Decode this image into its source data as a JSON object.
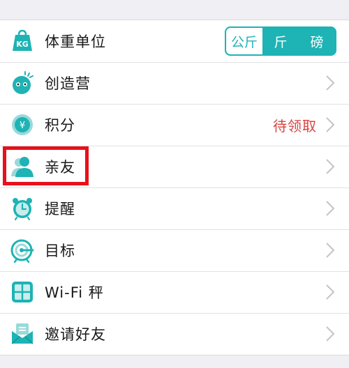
{
  "colors": {
    "accent": "#1eb3b4",
    "value_red": "#d9433f",
    "highlight": "#e8101a"
  },
  "rows": [
    {
      "label": "体重单位",
      "icon": "kg-weight-icon",
      "segment": {
        "options": [
          "公斤",
          "斤",
          "磅"
        ],
        "selected": "公斤"
      }
    },
    {
      "label": "创造营",
      "icon": "mascot-icon"
    },
    {
      "label": "积分",
      "icon": "yuan-coin-icon",
      "value": "待领取"
    },
    {
      "label": "亲友",
      "icon": "friends-icon"
    },
    {
      "label": "提醒",
      "icon": "alarm-clock-icon"
    },
    {
      "label": "目标",
      "icon": "target-icon"
    },
    {
      "label": "Wi-Fi 秤",
      "icon": "scale-icon"
    },
    {
      "label": "邀请好友",
      "icon": "envelope-icon"
    }
  ]
}
